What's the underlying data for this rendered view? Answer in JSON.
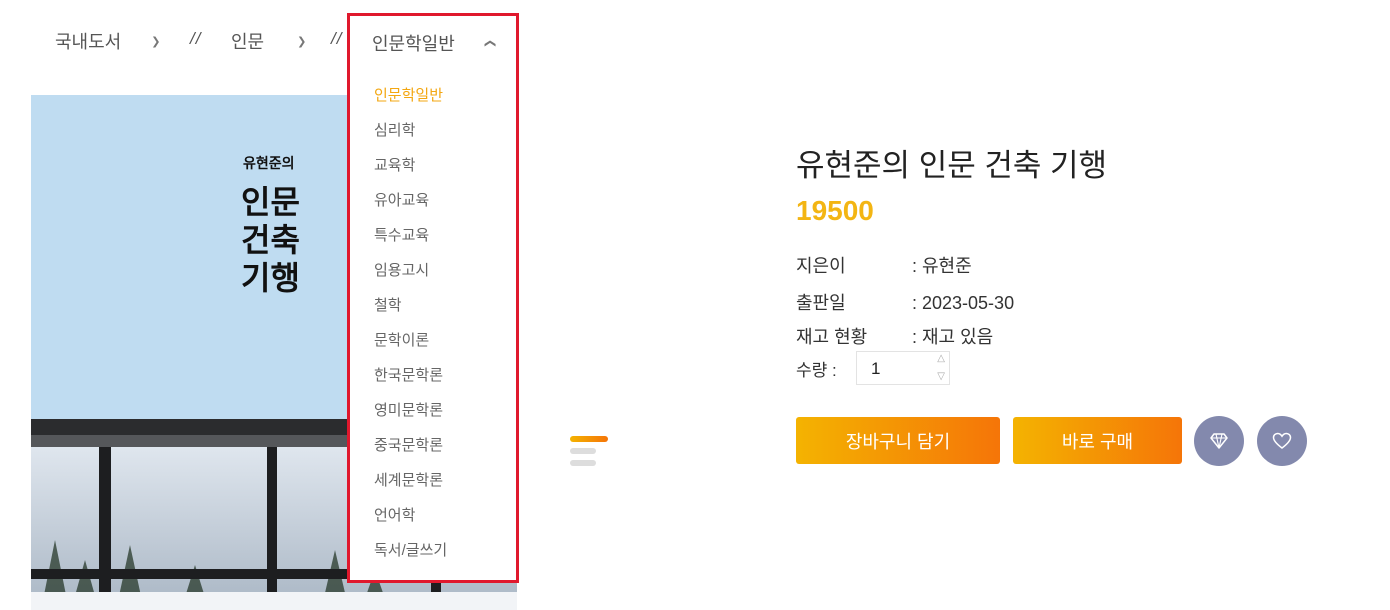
{
  "breadcrumb": {
    "level1": "국내도서",
    "level2": "인문",
    "level3": "인문학일반",
    "separator": "//"
  },
  "dropdown": {
    "selected": "인문학일반",
    "items": [
      "인문학일반",
      "심리학",
      "교육학",
      "유아교육",
      "특수교육",
      "임용고시",
      "철학",
      "문학이론",
      "한국문학론",
      "영미문학론",
      "중국문학론",
      "세계문학론",
      "언어학",
      "독서/글쓰기"
    ],
    "active_index": 0
  },
  "cover": {
    "subtitle": "유현준의",
    "title": "인문\n건축\n기행"
  },
  "product": {
    "title": "유현준의 인문 건축 기행",
    "price": "19500",
    "author_label": "지은이",
    "author_value": ": 유현준",
    "pubdate_label": "출판일",
    "pubdate_value": ": 2023-05-30",
    "stock_label": "재고 현황",
    "stock_value": ": 재고 있음",
    "qty_label": "수량 :",
    "qty_value": "1"
  },
  "actions": {
    "cart": "장바구니 담기",
    "buy": "바로 구매",
    "wishlist_icon": "diamond-icon",
    "like_icon": "heart-icon"
  },
  "colors": {
    "accent": "#f3b513",
    "dropdown_active": "#f3a712",
    "highlight_border": "#e0182d",
    "circle_button": "#8389ad",
    "button_gradient": [
      "#f4b301",
      "#f57508"
    ]
  }
}
